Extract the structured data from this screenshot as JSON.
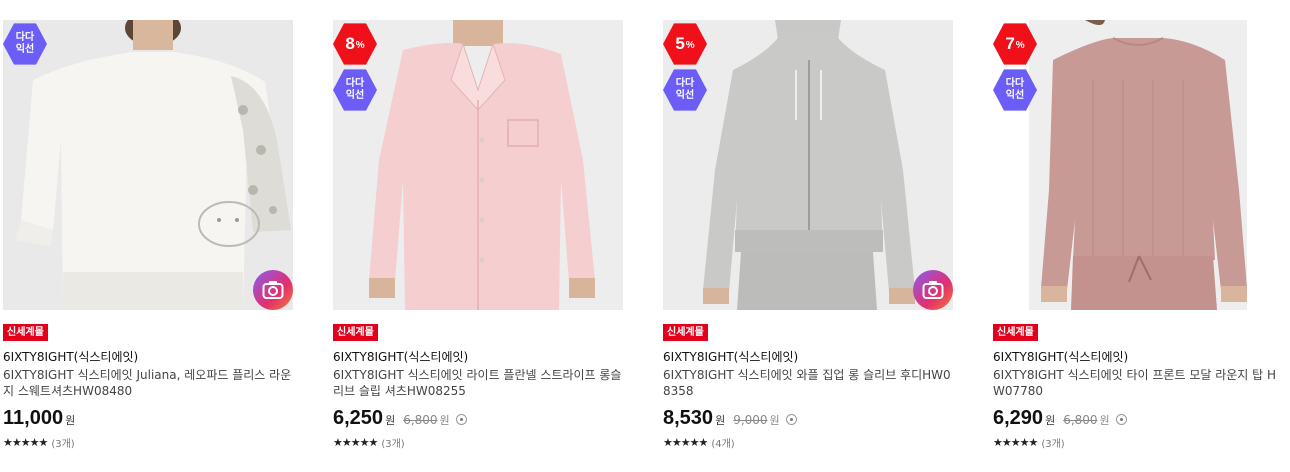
{
  "products": [
    {
      "dada_label_1": "다다",
      "dada_label_2": "익선",
      "tag": "신세계몰",
      "brand": "6IXTY8IGHT(식스티에잇)",
      "name": "6IXTY8IGHT 식스티에잇 Juliana, 레오파드 플리스 라운지 스웨트셔츠HW08480",
      "price": "11,000",
      "currency": "원",
      "stars": "★★★★★",
      "review_count": "(3개)",
      "has_camera": true
    },
    {
      "discount": "8",
      "discount_unit": "%",
      "dada_label_1": "다다",
      "dada_label_2": "익선",
      "tag": "신세계몰",
      "brand": "6IXTY8IGHT(식스티에잇)",
      "name": "6IXTY8IGHT 식스티에잇 라이트 플란넬 스트라이프 롱슬리브 슬립 셔츠HW08255",
      "price": "6,250",
      "currency": "원",
      "original_price": "6,800",
      "original_currency": "원",
      "stars": "★★★★★",
      "review_count": "(3개)"
    },
    {
      "discount": "5",
      "discount_unit": "%",
      "dada_label_1": "다다",
      "dada_label_2": "익선",
      "tag": "신세계몰",
      "brand": "6IXTY8IGHT(식스티에잇)",
      "name": "6IXTY8IGHT 식스티에잇 와플 집업 롱 슬리브 후디HW08358",
      "price": "8,530",
      "currency": "원",
      "original_price": "9,000",
      "original_currency": "원",
      "stars": "★★★★★",
      "review_count": "(4개)",
      "has_camera": true
    },
    {
      "discount": "7",
      "discount_unit": "%",
      "dada_label_1": "다다",
      "dada_label_2": "익선",
      "tag": "신세계몰",
      "brand": "6IXTY8IGHT(식스티에잇)",
      "name": "6IXTY8IGHT 식스티에잇 타이 프론트 모달 라운지 탑 HW07780",
      "price": "6,290",
      "currency": "원",
      "original_price": "6,800",
      "original_currency": "원",
      "stars": "★★★★★",
      "review_count": "(3개)"
    }
  ],
  "icons": {
    "camera": "camera-icon",
    "info": "info-circle-icon",
    "star": "star-icon"
  },
  "colors": {
    "discount_badge": "#f0101a",
    "dada_badge": "#6b5df5",
    "new_tag": "#e2001a"
  }
}
